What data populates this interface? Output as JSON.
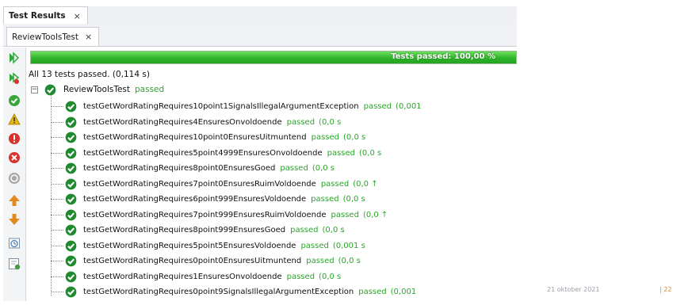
{
  "window": {
    "tab_title": "Test Results",
    "tab_close": "×"
  },
  "inner_tab": {
    "title": "ReviewToolsTest",
    "close": "×"
  },
  "toolbar": {
    "buttons": [
      {
        "name": "rerun-icon",
        "color": "#2fa83a"
      },
      {
        "name": "rerun-failed-icon",
        "color": "#2fa83a"
      },
      {
        "name": "show-passed-icon",
        "color": "#3aa63a"
      },
      {
        "name": "show-warnings-icon",
        "color": "#e5b812"
      },
      {
        "name": "show-failures-icon",
        "color": "#d9312b"
      },
      {
        "name": "show-errors-icon",
        "color": "#d9312b"
      },
      {
        "name": "show-aborted-icon",
        "color": "#9a9a9a"
      },
      {
        "name": "previous-failure-icon",
        "color": "#e08a1e"
      },
      {
        "name": "next-failure-icon",
        "color": "#e08a1e"
      },
      {
        "name": "test-history-icon",
        "color": "#4a7ec0"
      },
      {
        "name": "export-results-icon",
        "color": "#4a9a4a"
      }
    ]
  },
  "progress": {
    "label": "Tests passed: 100,00 %",
    "percent": 100
  },
  "summary": "All 13 tests passed. (0,114 s)",
  "suite": {
    "name": "ReviewToolsTest",
    "status": "passed"
  },
  "tests": [
    {
      "name": "testGetWordRatingRequires10point1SignalsIllegalArgumentException",
      "status": "passed",
      "time": "(0,001"
    },
    {
      "name": "testGetWordRatingRequires4EnsuresOnvoldoende",
      "status": "passed",
      "time": "(0,0 s"
    },
    {
      "name": "testGetWordRatingRequires10point0EnsuresUitmuntend",
      "status": "passed",
      "time": "(0,0 s"
    },
    {
      "name": "testGetWordRatingRequires5point4999EnsuresOnvoldoende",
      "status": "passed",
      "time": "(0,0 s"
    },
    {
      "name": "testGetWordRatingRequires8point0EnsuresGoed",
      "status": "passed",
      "time": "(0,0 s"
    },
    {
      "name": "testGetWordRatingRequires7point0EnsuresRuimVoldoende",
      "status": "passed",
      "time": "(0,0 ↑"
    },
    {
      "name": "testGetWordRatingRequires6point999EnsuresVoldoende",
      "status": "passed",
      "time": "(0,0 s"
    },
    {
      "name": "testGetWordRatingRequires7point999EnsuresRuimVoldoende",
      "status": "passed",
      "time": "(0,0 ↑"
    },
    {
      "name": "testGetWordRatingRequires8point999EnsuresGoed",
      "status": "passed",
      "time": "(0,0 s"
    },
    {
      "name": "testGetWordRatingRequires5point5EnsuresVoldoende",
      "status": "passed",
      "time": "(0,001 s"
    },
    {
      "name": "testGetWordRatingRequires0point0EnsuresUitmuntend",
      "status": "passed",
      "time": "(0,0 s"
    },
    {
      "name": "testGetWordRatingRequires1EnsuresOnvoldoende",
      "status": "passed",
      "time": "(0,0 s"
    },
    {
      "name": "testGetWordRatingRequires0point9SignalsIllegalArgumentException",
      "status": "passed",
      "time": "(0,001"
    }
  ],
  "footer": {
    "date": "21 oktober 2021",
    "page": "| 22"
  },
  "colors": {
    "pass": "#2aa52a",
    "check_fill": "#1f8a2e",
    "progress": "#2fb52a"
  }
}
